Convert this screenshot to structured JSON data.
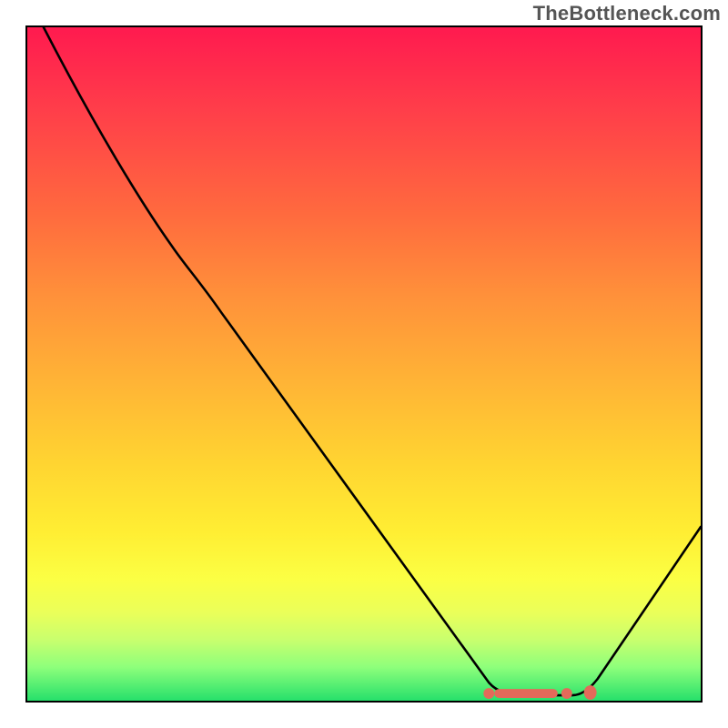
{
  "watermark": "TheBottleneck.com",
  "colors": {
    "gradient_top": "#ff1a4f",
    "gradient_bottom": "#26e06b",
    "curve": "#000000",
    "markers": "#e36a5a",
    "border": "#000000"
  },
  "chart_data": {
    "type": "line",
    "title": "",
    "xlabel": "",
    "ylabel": "",
    "xlim": [
      0,
      100
    ],
    "ylim": [
      0,
      100
    ],
    "grid": false,
    "legend": false,
    "series": [
      {
        "name": "bottleneck-curve",
        "x": [
          2,
          10,
          18,
          22,
          28,
          35,
          45,
          55,
          63,
          68,
          72,
          76,
          80,
          82,
          85,
          90,
          95,
          100
        ],
        "y": [
          100,
          88,
          73,
          67,
          60,
          52,
          38,
          24,
          12,
          4,
          1,
          1,
          1,
          2,
          6,
          14,
          22,
          26
        ]
      }
    ],
    "annotations": [
      {
        "name": "optimal-range-start",
        "x": 68,
        "y": 1
      },
      {
        "name": "optimal-range-end",
        "x": 82,
        "y": 1
      }
    ],
    "background": {
      "type": "vertical-gradient",
      "meaning": "higher y = worse (red), lower y = better (green)"
    }
  }
}
